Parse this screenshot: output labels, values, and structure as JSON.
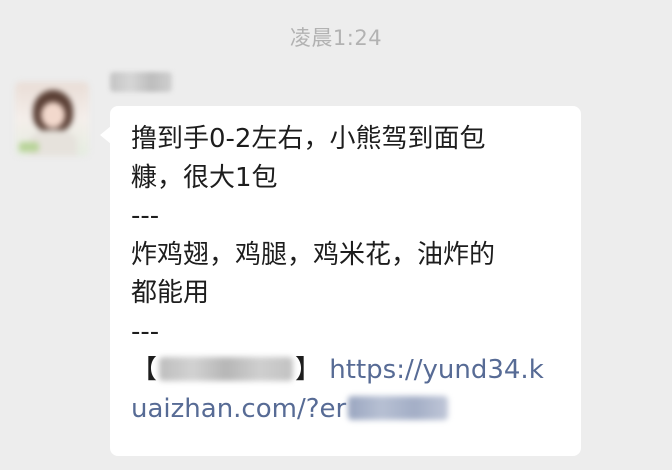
{
  "timestamp": "凌晨1:24",
  "message": {
    "lines": [
      "撸到手0-2左右，小熊驾到面包",
      "糠，很大1包",
      "---",
      "炸鸡翅，鸡腿，鸡米花，油炸的",
      "都能用",
      "---"
    ],
    "bracket_open": "【",
    "bracket_close": "】",
    "link_part1": "https://yund34.k",
    "link_part2": "uaizhan.com/?er"
  },
  "colors": {
    "background": "#ededed",
    "bubble": "#ffffff",
    "link": "#576b95",
    "timestamp": "#b2b2b2"
  }
}
